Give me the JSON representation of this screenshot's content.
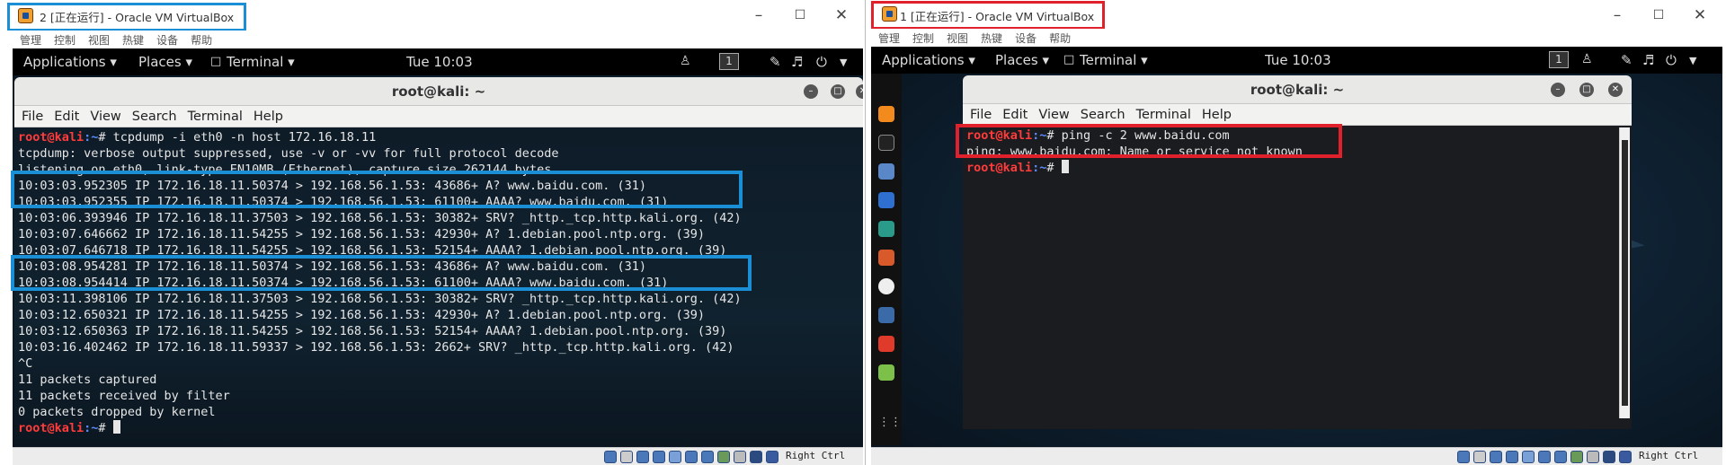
{
  "left_window": {
    "title": "2 [正在运行] - Oracle VM VirtualBox",
    "menu": [
      "管理",
      "控制",
      "视图",
      "热键",
      "设备",
      "帮助"
    ],
    "topbar": {
      "applications": "Applications ▾",
      "places": "Places ▾",
      "terminal": "Terminal ▾",
      "time": "Tue 10:03",
      "workspace": "1"
    },
    "terminal": {
      "title": "root@kali: ~",
      "menu": [
        "File",
        "Edit",
        "View",
        "Search",
        "Terminal",
        "Help"
      ],
      "prompt_user": "root@kali",
      "prompt_path": ":~",
      "command": "# tcpdump -i eth0 -n host 172.16.18.11",
      "output": [
        "tcpdump: verbose output suppressed, use -v or -vv for full protocol decode",
        "listening on eth0, link-type EN10MB (Ethernet), capture size 262144 bytes",
        "10:03:03.952305 IP 172.16.18.11.50374 > 192.168.56.1.53: 43686+ A? www.baidu.com. (31)",
        "10:03:03.952355 IP 172.16.18.11.50374 > 192.168.56.1.53: 61100+ AAAA? www.baidu.com. (31)",
        "10:03:06.393946 IP 172.16.18.11.37503 > 192.168.56.1.53: 30382+ SRV? _http._tcp.http.kali.org. (42)",
        "10:03:07.646662 IP 172.16.18.11.54255 > 192.168.56.1.53: 42930+ A? 1.debian.pool.ntp.org. (39)",
        "10:03:07.646718 IP 172.16.18.11.54255 > 192.168.56.1.53: 52154+ AAAA? 1.debian.pool.ntp.org. (39)",
        "10:03:08.954281 IP 172.16.18.11.50374 > 192.168.56.1.53: 43686+ A? www.baidu.com. (31)",
        "10:03:08.954414 IP 172.16.18.11.50374 > 192.168.56.1.53: 61100+ AAAA? www.baidu.com. (31)",
        "10:03:11.398106 IP 172.16.18.11.37503 > 192.168.56.1.53: 30382+ SRV? _http._tcp.http.kali.org. (42)",
        "10:03:12.650321 IP 172.16.18.11.54255 > 192.168.56.1.53: 42930+ A? 1.debian.pool.ntp.org. (39)",
        "10:03:12.650363 IP 172.16.18.11.54255 > 192.168.56.1.53: 52154+ AAAA? 1.debian.pool.ntp.org. (39)",
        "10:03:16.402462 IP 172.16.18.11.59337 > 192.168.56.1.53: 2662+ SRV? _http._tcp.http.kali.org. (42)",
        "^C",
        "11 packets captured",
        "11 packets received by filter",
        "0 packets dropped by kernel"
      ],
      "final_prompt_suffix": "# "
    },
    "status_hotkey": "Right Ctrl"
  },
  "right_window": {
    "title": "1 [正在运行] - Oracle VM VirtualBox",
    "menu": [
      "管理",
      "控制",
      "视图",
      "热键",
      "设备",
      "帮助"
    ],
    "topbar": {
      "applications": "Applications ▾",
      "places": "Places ▾",
      "terminal": "Terminal ▾",
      "time": "Tue 10:03",
      "workspace": "1"
    },
    "terminal": {
      "title": "root@kali: ~",
      "menu": [
        "File",
        "Edit",
        "View",
        "Search",
        "Terminal",
        "Help"
      ],
      "prompt_user": "root@kali",
      "prompt_path": ":~",
      "command": "# ping -c 2 www.baidu.com",
      "output": [
        "ping: www.baidu.com: Name or service not known"
      ],
      "final_prompt_suffix": "# "
    },
    "status_hotkey": "Right Ctrl"
  },
  "colors": {
    "highlight_blue": "#1a8fd6",
    "highlight_red": "#e0202a",
    "prompt_red": "#ff3b3b",
    "prompt_blue": "#5b8bff"
  }
}
